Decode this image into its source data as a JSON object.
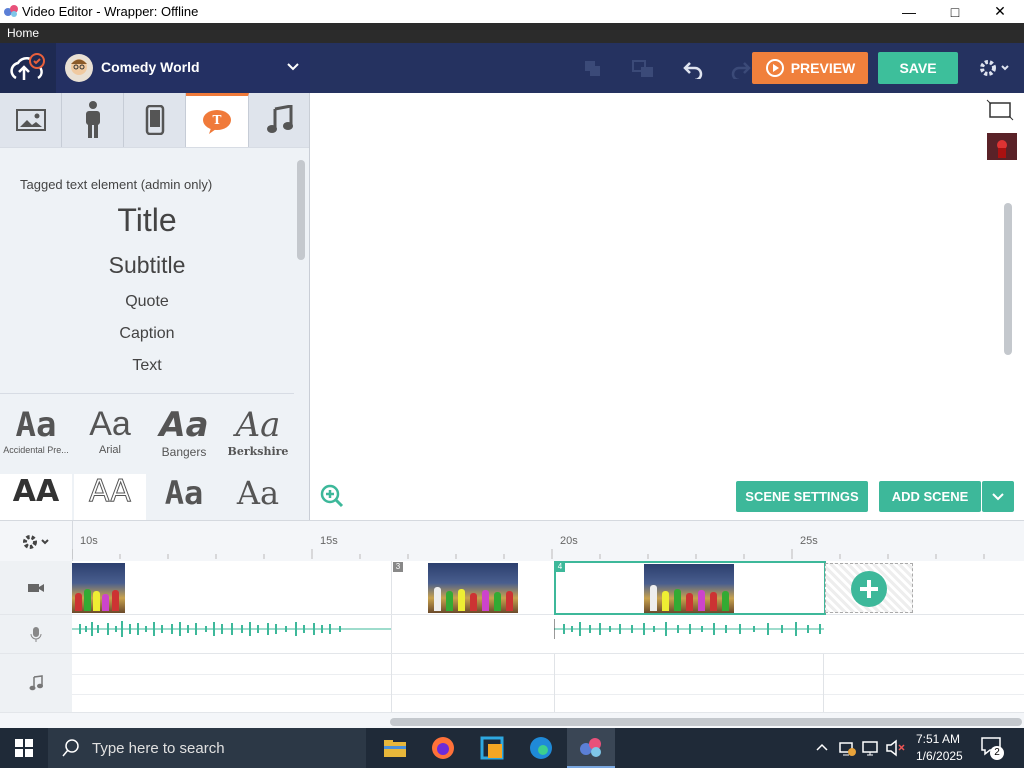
{
  "window": {
    "title": "Video Editor - Wrapper: Offline",
    "min": "—",
    "max": "□",
    "close": "✕"
  },
  "menu": {
    "home": "Home"
  },
  "header": {
    "user_name": "Comedy World",
    "preview_label": "PREVIEW",
    "save_label": "SAVE",
    "accent_orange": "#f0803c",
    "accent_teal": "#3dbf9b"
  },
  "left_tabs": [
    {
      "name": "image-tab",
      "icon": "image-icon"
    },
    {
      "name": "character-tab",
      "icon": "person-icon"
    },
    {
      "name": "prop-tab",
      "icon": "phone-icon"
    },
    {
      "name": "text-tab",
      "icon": "text-bubble-icon",
      "active": true
    },
    {
      "name": "sound-tab",
      "icon": "music-note-icon"
    }
  ],
  "text_panel": {
    "header": "Tagged text element (admin only)",
    "styles": [
      "Title",
      "Subtitle",
      "Quote",
      "Caption",
      "Text"
    ]
  },
  "fonts": [
    {
      "sample": "Aa",
      "label": "Accidental Pre..."
    },
    {
      "sample": "Aa",
      "label": "Arial"
    },
    {
      "sample": "Aa",
      "label": "Bangers"
    },
    {
      "sample": "Aa",
      "label": "Berkshire"
    },
    {
      "sample": "AA",
      "label": ""
    },
    {
      "sample": "AA",
      "label": ""
    },
    {
      "sample": "Aa",
      "label": ""
    },
    {
      "sample": "Aa",
      "label": ""
    }
  ],
  "stage": {
    "scene_settings_label": "SCENE SETTINGS",
    "add_scene_label": "ADD SCENE"
  },
  "timeline": {
    "ruler": [
      "10s",
      "15s",
      "20s",
      "25s"
    ],
    "scene_numbers": [
      "3",
      "4"
    ]
  },
  "taskbar": {
    "search_placeholder": "Type here to search",
    "time": "7:51 AM",
    "date": "1/6/2025",
    "notifications": "2"
  }
}
